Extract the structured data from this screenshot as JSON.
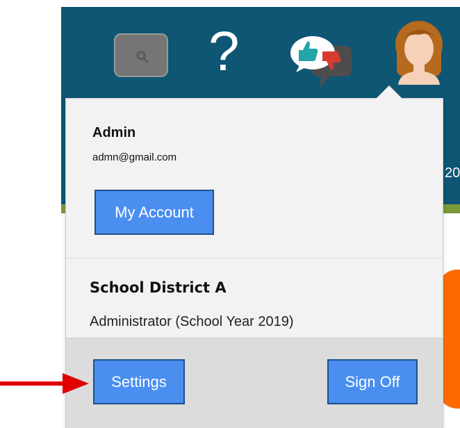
{
  "header": {
    "search_icon": "magnifier-icon",
    "help_label": "?",
    "feedback_icon": "thumbs-feedback-icon",
    "avatar_icon": "user-avatar-icon",
    "partial_right_text": "20"
  },
  "user_menu": {
    "name": "Admin",
    "email": "admn@gmail.com",
    "my_account_label": "My Account",
    "district_name": "School District A",
    "role": "Administrator (School Year 2019)",
    "settings_label": "Settings",
    "sign_off_label": "Sign Off"
  },
  "annotation": {
    "arrow_icon": "red-arrow-icon"
  },
  "colors": {
    "header_bg": "#0e5674",
    "button_bg": "#4a8ef0",
    "arrow": "#e00000",
    "orange": "#ff6a00"
  }
}
